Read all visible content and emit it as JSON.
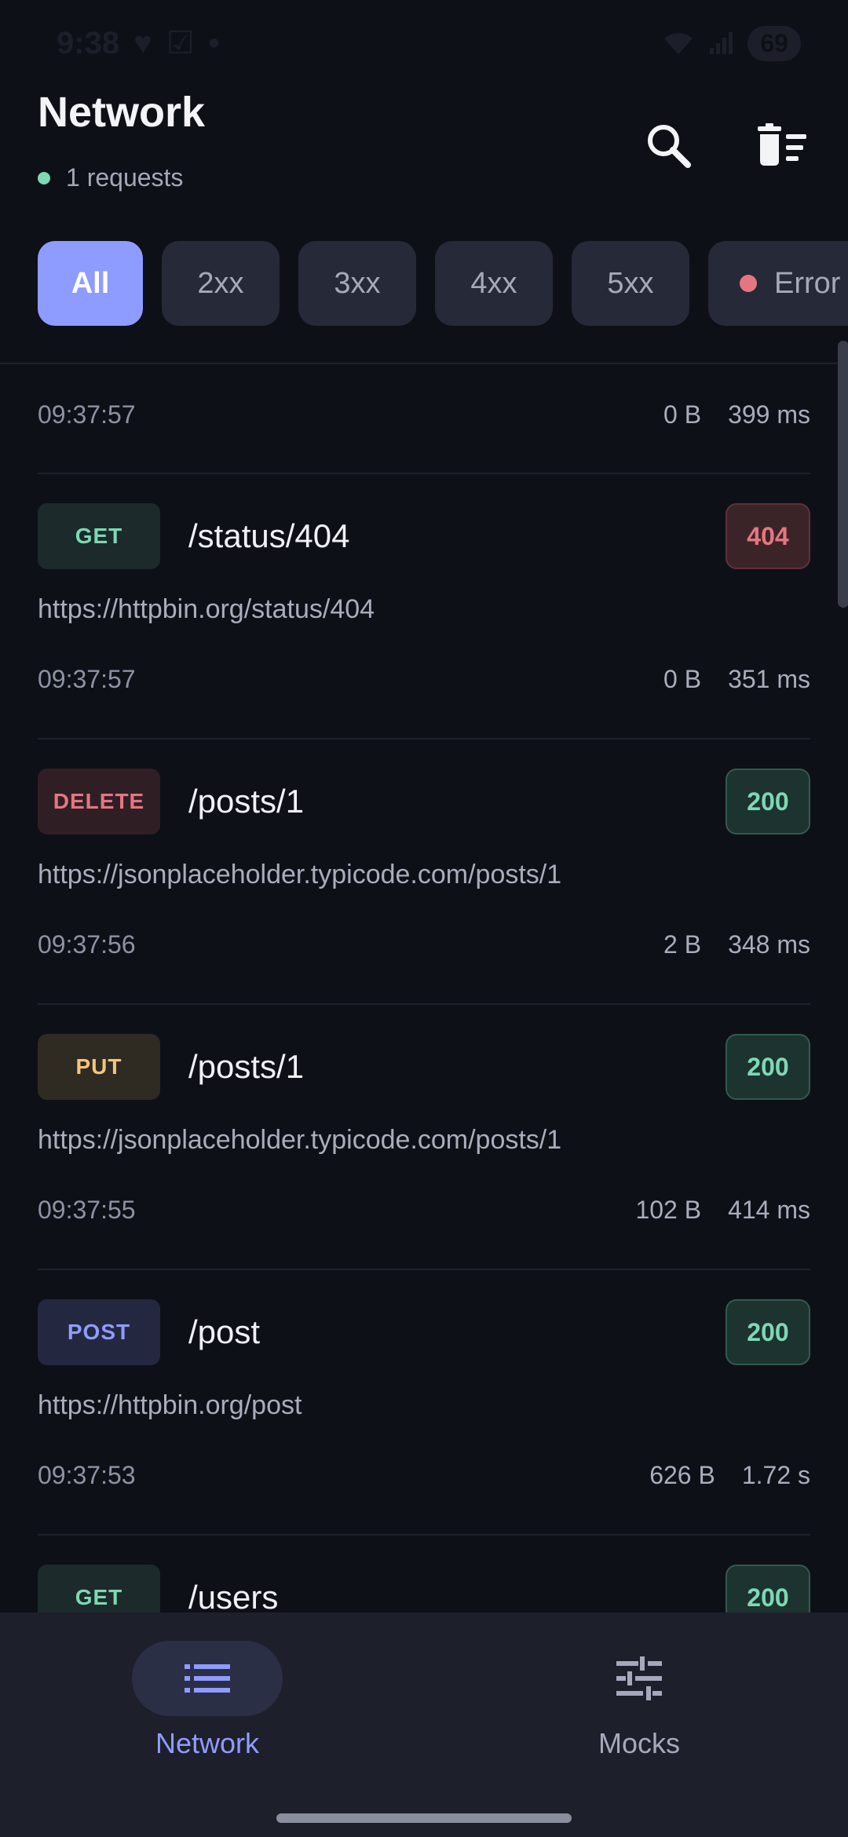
{
  "status_bar": {
    "time": "9:38",
    "battery": "69"
  },
  "header": {
    "title": "Network",
    "subtitle": "1 requests"
  },
  "filters": [
    "All",
    "2xx",
    "3xx",
    "4xx",
    "5xx",
    "Error"
  ],
  "partial_row": {
    "time": "09:37:57",
    "size": "0 B",
    "duration": "399 ms"
  },
  "requests": [
    {
      "method": "GET",
      "path": "/status/404",
      "code": "404",
      "url": "https://httpbin.org/status/404",
      "time": "09:37:57",
      "size": "0 B",
      "duration": "351 ms"
    },
    {
      "method": "DELETE",
      "path": "/posts/1",
      "code": "200",
      "url": "https://jsonplaceholder.typicode.com/posts/1",
      "time": "09:37:56",
      "size": "2 B",
      "duration": "348 ms"
    },
    {
      "method": "PUT",
      "path": "/posts/1",
      "code": "200",
      "url": "https://jsonplaceholder.typicode.com/posts/1",
      "time": "09:37:55",
      "size": "102 B",
      "duration": "414 ms"
    },
    {
      "method": "POST",
      "path": "/post",
      "code": "200",
      "url": "https://httpbin.org/post",
      "time": "09:37:53",
      "size": "626 B",
      "duration": "1.72 s"
    },
    {
      "method": "GET",
      "path": "/users",
      "code": "200"
    }
  ],
  "nav": {
    "network": "Network",
    "mocks": "Mocks"
  }
}
